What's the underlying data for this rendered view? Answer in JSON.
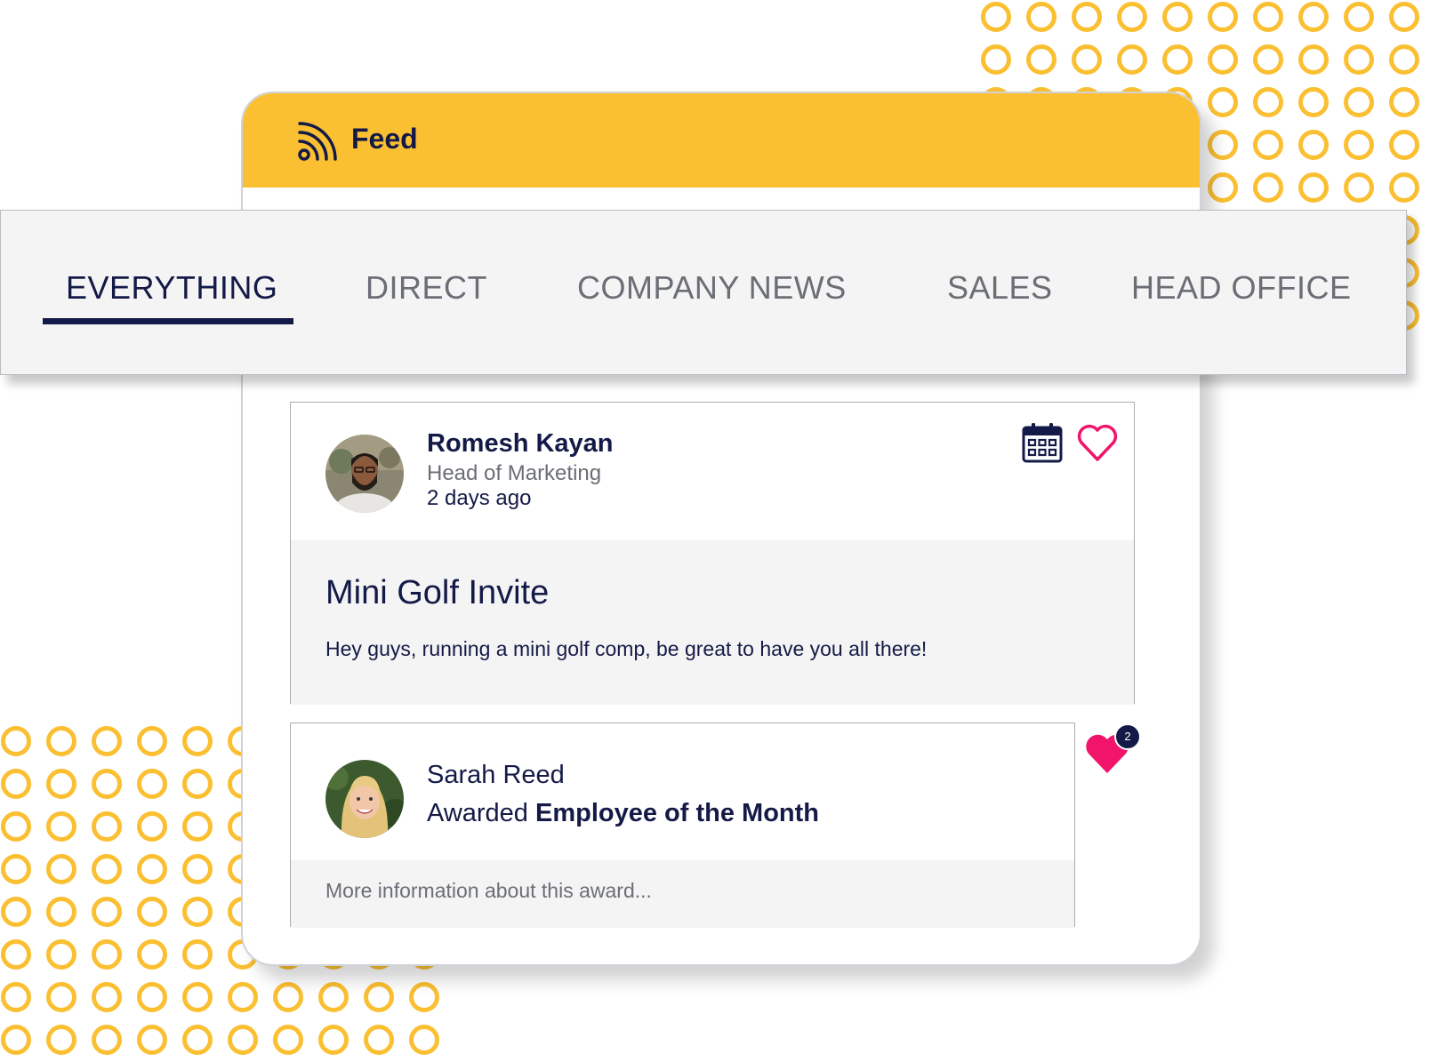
{
  "header": {
    "title": "Feed",
    "icon": "rss-feed-icon",
    "color": "#fbbf32"
  },
  "tabs": [
    {
      "label": "EVERYTHING",
      "active": true
    },
    {
      "label": "DIRECT",
      "active": false
    },
    {
      "label": "COMPANY NEWS",
      "active": false
    },
    {
      "label": "SALES",
      "active": false
    },
    {
      "label": "HEAD OFFICE",
      "active": false
    }
  ],
  "posts": [
    {
      "author": "Romesh Kayan",
      "role": "Head of Marketing",
      "time": "2 days ago",
      "title": "Mini Golf Invite",
      "text": "Hey guys, running a mini golf comp, be great to have you all there!",
      "icons": [
        "calendar-icon",
        "heart-outline-icon"
      ]
    },
    {
      "author": "Sarah Reed",
      "award_prefix": "Awarded ",
      "award_name": "Employee of the Month",
      "footer": "More information about this award...",
      "likes": "2"
    }
  ],
  "colors": {
    "brand_yellow": "#fbbf32",
    "navy": "#141a47",
    "heart_pink": "#f0146b",
    "panel_grey": "#f4f4f4"
  }
}
